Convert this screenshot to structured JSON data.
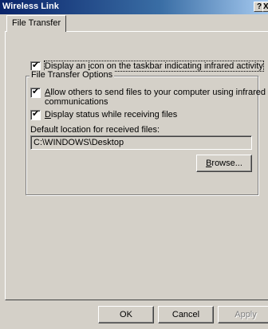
{
  "window": {
    "title": "Wireless Link",
    "help_glyph": "?",
    "close_glyph": "X"
  },
  "tabs": [
    {
      "label": "File Transfer"
    }
  ],
  "settings": {
    "taskbar_icon": {
      "label_pre": "Display an ",
      "label_accel": "i",
      "label_post": "con on the taskbar indicating infrared activity",
      "checked": true
    },
    "group_title": "File Transfer Options",
    "allow_send": {
      "label_accel": "A",
      "label_post_line1": "llow others to send files to your computer using infrared",
      "label_line2": "communications",
      "checked": true
    },
    "display_status": {
      "label_accel": "D",
      "label_post": "isplay status while receiving files",
      "checked": true
    },
    "location_label": "Default location for received files:",
    "location_value": "C:\\WINDOWS\\Desktop",
    "browse_accel": "B",
    "browse_post": "rowse..."
  },
  "buttons": {
    "ok": "OK",
    "cancel": "Cancel",
    "apply": "Apply"
  },
  "checkmark": "✔"
}
